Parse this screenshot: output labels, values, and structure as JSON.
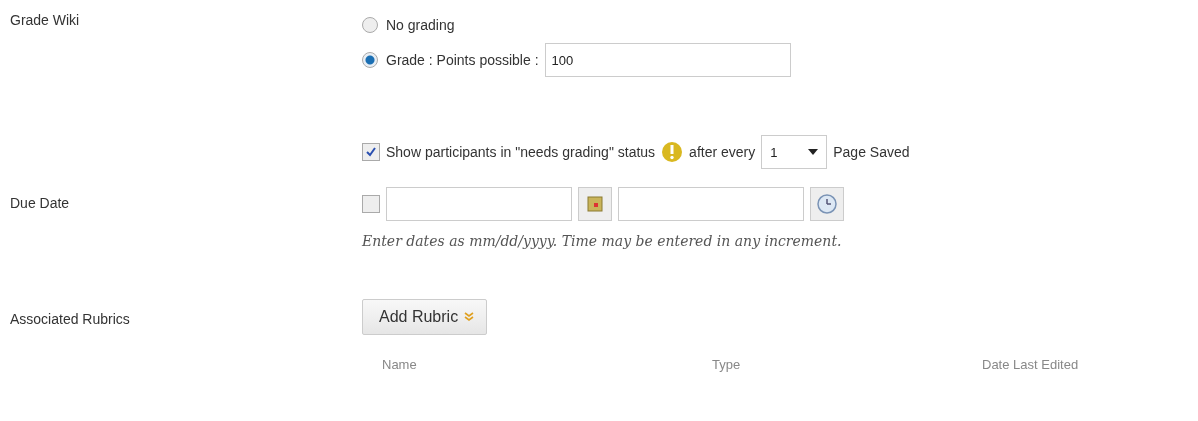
{
  "grade": {
    "label": "Grade Wiki",
    "options": [
      {
        "label": "No grading",
        "selected": false
      },
      {
        "label": "Grade : Points possible :",
        "selected": true,
        "value": "100"
      }
    ]
  },
  "needs_grading": {
    "checked": true,
    "label": "Show participants in \"needs grading\" status",
    "after": "after every",
    "count": "1",
    "suffix": "Page Saved"
  },
  "due_date": {
    "label": "Due Date",
    "checked": false,
    "hint": "Enter dates as mm/dd/yyyy. Time may be entered in any increment."
  },
  "rubrics": {
    "label": "Associated Rubrics",
    "button": "Add Rubric",
    "columns": [
      "Name",
      "Type",
      "Date Last Edited"
    ]
  }
}
